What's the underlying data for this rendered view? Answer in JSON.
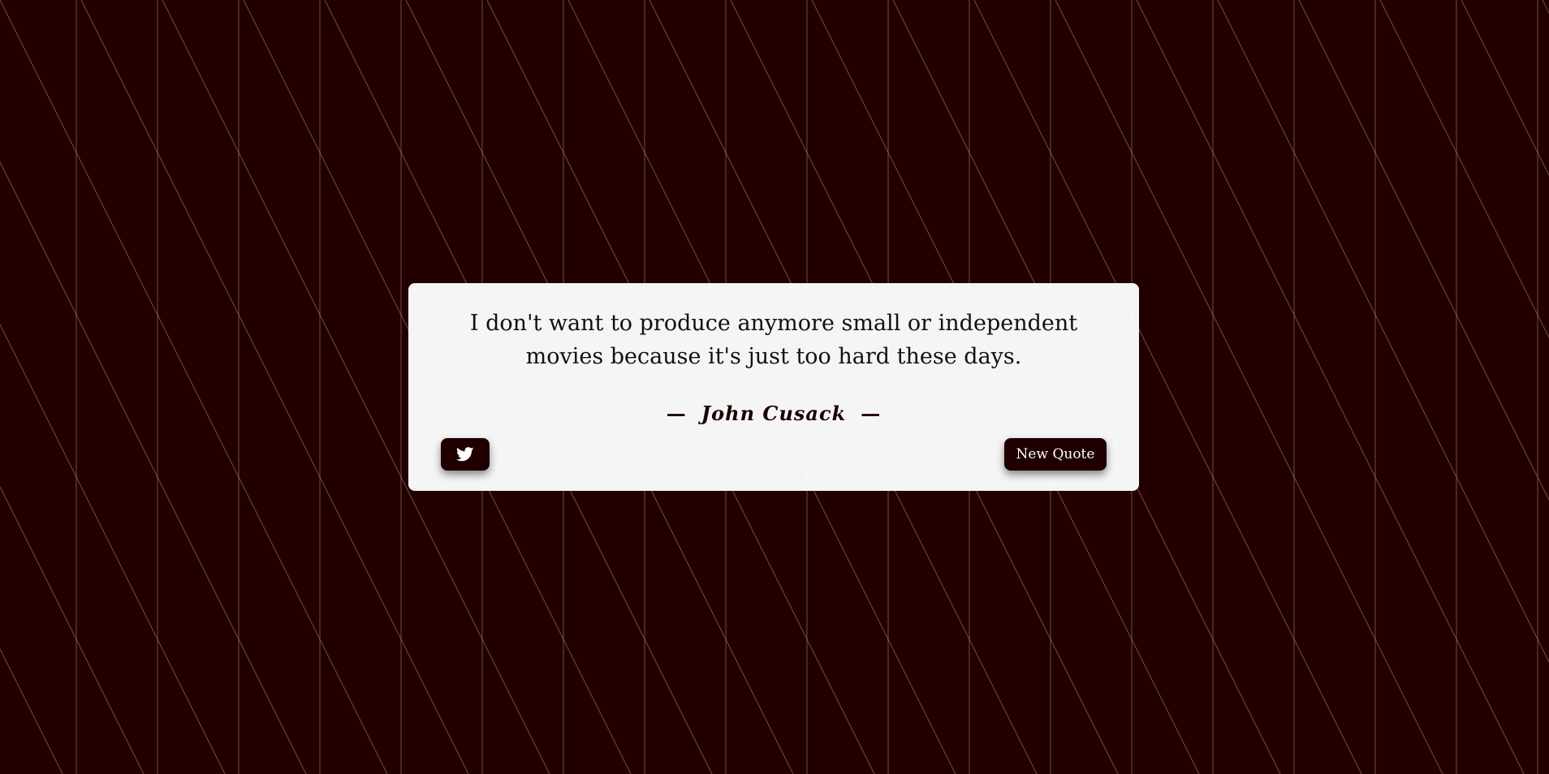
{
  "quote": {
    "text": "I don't want to produce anymore small or independent movies because it's just too hard these days.",
    "author": "John Cusack",
    "dash": "—"
  },
  "buttons": {
    "tweet_icon": "twitter-icon",
    "new_quote_label": "New Quote"
  },
  "colors": {
    "background": "#220000",
    "card": "#f5f3f3",
    "button": "#1e0000",
    "pattern_line": "#b08a8a"
  }
}
